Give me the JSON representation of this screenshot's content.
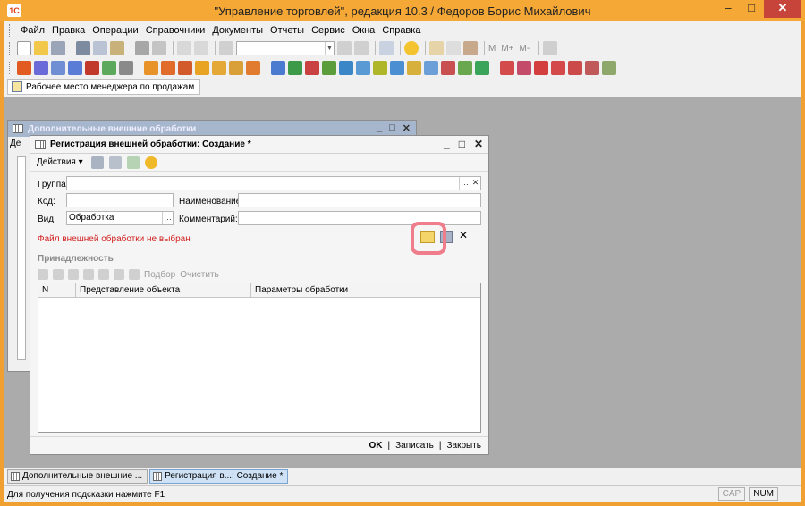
{
  "window": {
    "title": "\"Управление торговлей\", редакция 10.3 / Федоров Борис Михайлович",
    "logo": "1С"
  },
  "menu": [
    "Файл",
    "Правка",
    "Операции",
    "Справочники",
    "Документы",
    "Отчеты",
    "Сервис",
    "Окна",
    "Справка"
  ],
  "toolbar1": {
    "labels": [
      "M",
      "M+",
      "M-"
    ]
  },
  "panel_tab": "Рабочее место менеджера по продажам",
  "background_window": {
    "title": "Дополнительные внешние обработки",
    "partial_label": "Де"
  },
  "dialog": {
    "title": "Регистрация внешней обработки: Создание *",
    "actions_label": "Действия",
    "fields": {
      "group_label": "Группа:",
      "code_label": "Код:",
      "name_label": "Наименование:",
      "kind_label": "Вид:",
      "kind_value": "Обработка",
      "comment_label": "Комментарий:"
    },
    "error_text": "Файл внешней обработки не выбран",
    "section_title": "Принадлежность",
    "grid_toolbar": {
      "select_label": "Подбор",
      "clear_label": "Очистить"
    },
    "grid_columns": [
      "N",
      "Представление объекта",
      "Параметры обработки"
    ],
    "footer": {
      "ok_label": "OK",
      "save_label": "Записать",
      "close_label": "Закрыть"
    }
  },
  "taskbar": [
    {
      "label": "Дополнительные внешние ...",
      "active": false
    },
    {
      "label": "Регистрация в...: Создание *",
      "active": true
    }
  ],
  "status": {
    "hint": "Для получения подсказки нажмите F1",
    "cap": "CAP",
    "num": "NUM"
  },
  "colors": {
    "title_bar": "#f5a836",
    "error": "#d21f1f",
    "highlight": "#f07d8c"
  }
}
